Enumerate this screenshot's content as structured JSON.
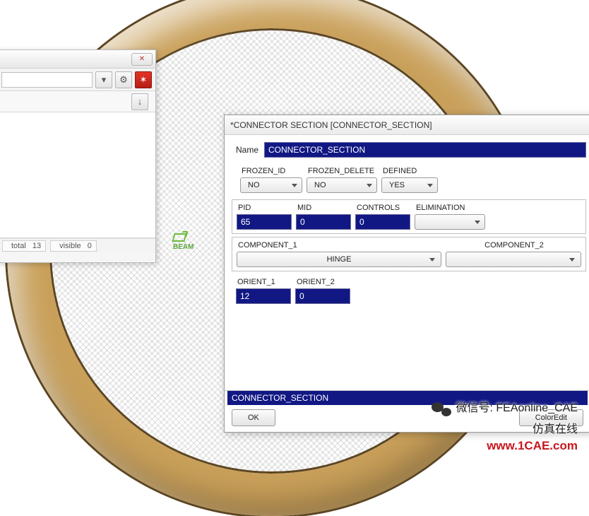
{
  "left_panel": {
    "status_total_label": "total",
    "status_total_value": "13",
    "status_visible_label": "visible",
    "status_visible_value": "0"
  },
  "beam_label": "BEAM",
  "dialog": {
    "title": "*CONNECTOR SECTION [CONNECTOR_SECTION]",
    "name_label": "Name",
    "name_value": "CONNECTOR_SECTION",
    "row1": {
      "frozen_id_label": "FROZEN_ID",
      "frozen_id_value": "NO",
      "frozen_delete_label": "FROZEN_DELETE",
      "frozen_delete_value": "NO",
      "defined_label": "DEFINED",
      "defined_value": "YES"
    },
    "row2": {
      "pid_label": "PID",
      "pid_value": "65",
      "mid_label": "MID",
      "mid_value": "0",
      "controls_label": "CONTROLS",
      "controls_value": "0",
      "elimination_label": "ELIMINATION",
      "elimination_value": ""
    },
    "row3": {
      "component1_label": "COMPONENT_1",
      "component1_value": "HINGE",
      "component2_label": "COMPONENT_2",
      "component2_value": ""
    },
    "row4": {
      "orient1_label": "ORIENT_1",
      "orient1_value": "12",
      "orient2_label": "ORIENT_2",
      "orient2_value": "0"
    },
    "footer_banner": "CONNECTOR_SECTION",
    "ok_label": "OK",
    "coloredit_label": "ColorEdit"
  },
  "watermark": {
    "wx_label": "微信号: FEAonline_CAE",
    "cn_label": "仿真在线",
    "url": "www.1CAE.com"
  },
  "bg_watermark": "1CAE.COM"
}
